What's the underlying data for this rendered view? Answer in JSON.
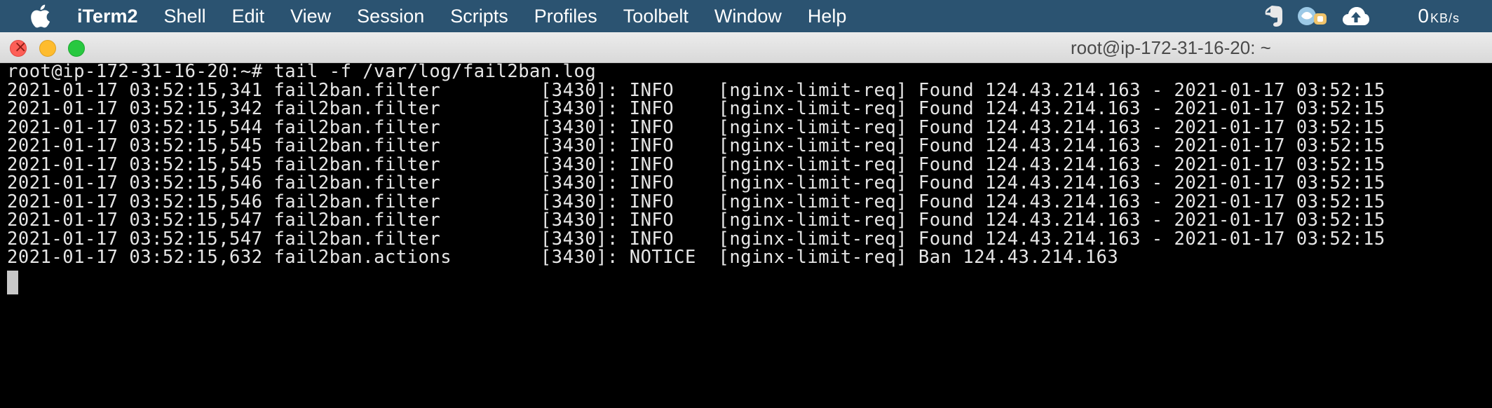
{
  "menubar": {
    "app_name": "iTerm2",
    "items": [
      "Shell",
      "Edit",
      "View",
      "Session",
      "Scripts",
      "Profiles",
      "Toolbelt",
      "Window",
      "Help"
    ],
    "netspeed_value": "0",
    "netspeed_unit": "KB/s",
    "status_icons": [
      "evernote-icon",
      "menu-extra-icon",
      "cloud-upload-icon"
    ]
  },
  "window": {
    "title": "root@ip-172-31-16-20: ~"
  },
  "terminal": {
    "lines": [
      "root@ip-172-31-16-20:~# tail -f /var/log/fail2ban.log",
      "2021-01-17 03:52:15,341 fail2ban.filter         [3430]: INFO    [nginx-limit-req] Found 124.43.214.163 - 2021-01-17 03:52:15",
      "2021-01-17 03:52:15,342 fail2ban.filter         [3430]: INFO    [nginx-limit-req] Found 124.43.214.163 - 2021-01-17 03:52:15",
      "2021-01-17 03:52:15,544 fail2ban.filter         [3430]: INFO    [nginx-limit-req] Found 124.43.214.163 - 2021-01-17 03:52:15",
      "2021-01-17 03:52:15,545 fail2ban.filter         [3430]: INFO    [nginx-limit-req] Found 124.43.214.163 - 2021-01-17 03:52:15",
      "2021-01-17 03:52:15,545 fail2ban.filter         [3430]: INFO    [nginx-limit-req] Found 124.43.214.163 - 2021-01-17 03:52:15",
      "2021-01-17 03:52:15,546 fail2ban.filter         [3430]: INFO    [nginx-limit-req] Found 124.43.214.163 - 2021-01-17 03:52:15",
      "2021-01-17 03:52:15,546 fail2ban.filter         [3430]: INFO    [nginx-limit-req] Found 124.43.214.163 - 2021-01-17 03:52:15",
      "2021-01-17 03:52:15,547 fail2ban.filter         [3430]: INFO    [nginx-limit-req] Found 124.43.214.163 - 2021-01-17 03:52:15",
      "2021-01-17 03:52:15,547 fail2ban.filter         [3430]: INFO    [nginx-limit-req] Found 124.43.214.163 - 2021-01-17 03:52:15",
      "2021-01-17 03:52:15,632 fail2ban.actions        [3430]: NOTICE  [nginx-limit-req] Ban 124.43.214.163"
    ]
  },
  "colors": {
    "menubar_bg": "#2b5371",
    "terminal_bg": "#000000",
    "terminal_fg": "#e6e6e6",
    "close": "#fd5f57",
    "minimize": "#febc2e",
    "maximize": "#28c840"
  }
}
